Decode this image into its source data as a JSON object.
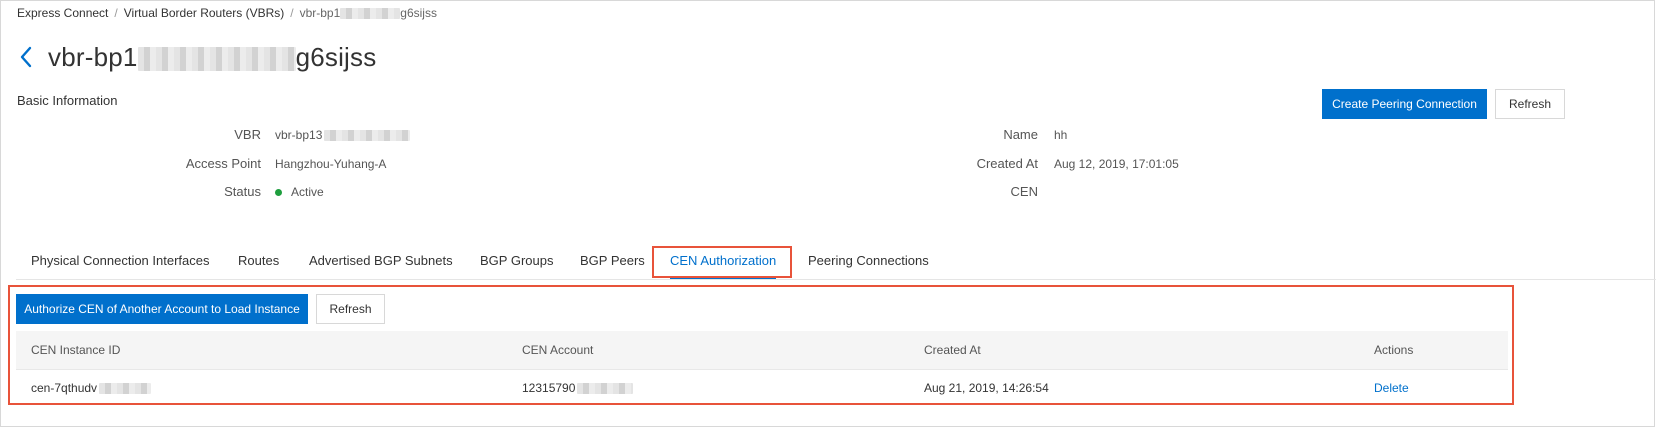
{
  "breadcrumb": {
    "items": [
      "Express Connect",
      "Virtual Border Routers (VBRs)"
    ],
    "separator": "/",
    "current_prefix": "vbr-bp1",
    "current_suffix": "g6sijss"
  },
  "header": {
    "title_prefix": "vbr-bp1",
    "title_suffix": "g6sijss"
  },
  "basic_info": {
    "section_title": "Basic Information",
    "create_peering_label": "Create Peering Connection",
    "refresh_label": "Refresh",
    "fields_left": [
      {
        "label": "VBR",
        "value": "vbr-bp13"
      },
      {
        "label": "Access Point",
        "value": "Hangzhou-Yuhang-A"
      },
      {
        "label": "Status",
        "value": "Active"
      }
    ],
    "fields_right": [
      {
        "label": "Name",
        "value": "hh"
      },
      {
        "label": "Created At",
        "value": "Aug 12, 2019, 17:01:05"
      },
      {
        "label": "CEN",
        "value": ""
      }
    ]
  },
  "tabs": [
    {
      "label": "Physical Connection Interfaces",
      "active": false
    },
    {
      "label": "Routes",
      "active": false
    },
    {
      "label": "Advertised BGP Subnets",
      "active": false
    },
    {
      "label": "BGP Groups",
      "active": false
    },
    {
      "label": "BGP Peers",
      "active": false
    },
    {
      "label": "CEN Authorization",
      "active": true
    },
    {
      "label": "Peering Connections",
      "active": false
    }
  ],
  "cen_panel": {
    "authorize_label": "Authorize CEN of Another Account to Load Instance",
    "refresh_label": "Refresh",
    "columns": [
      "CEN Instance ID",
      "CEN Account",
      "Created At",
      "Actions"
    ],
    "rows": [
      {
        "instance_id": "cen-7qthudv",
        "account": "12315790",
        "created_at": "Aug 21, 2019, 14:26:54",
        "action": "Delete"
      }
    ]
  },
  "colors": {
    "primary": "#0070cc",
    "highlight": "#e8533a",
    "status_active": "#1e9e3e"
  }
}
